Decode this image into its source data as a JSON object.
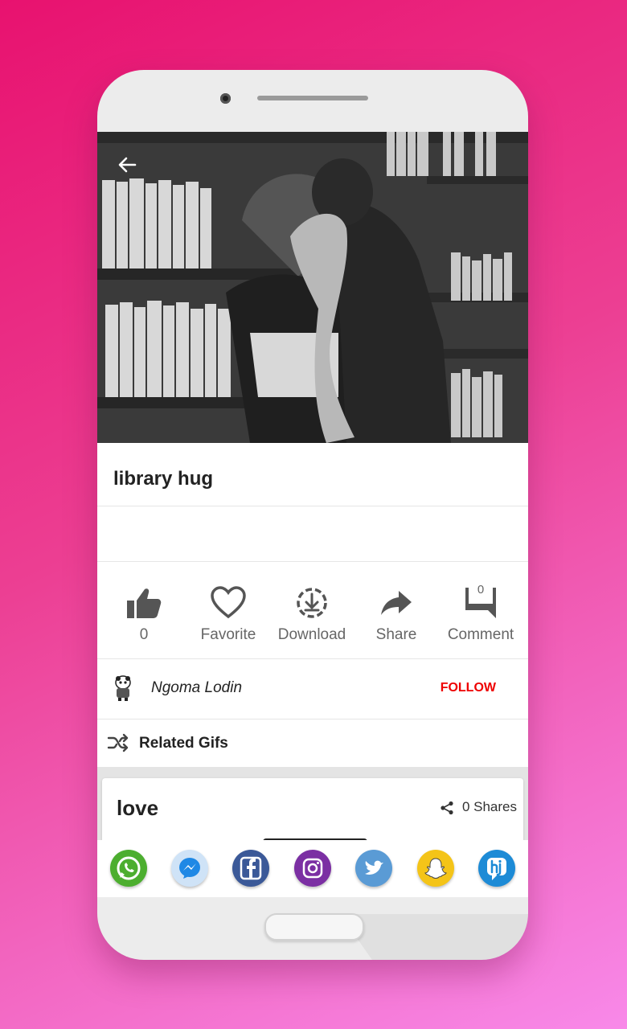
{
  "post": {
    "title": "library hug"
  },
  "actions": {
    "like": {
      "label": "0"
    },
    "favorite": {
      "label": "Favorite"
    },
    "download": {
      "label": "Download"
    },
    "share": {
      "label": "Share"
    },
    "comment": {
      "label": "Comment",
      "count": "0"
    }
  },
  "author": {
    "name": "Ngoma Lodin",
    "follow_label": "FOLLOW"
  },
  "related": {
    "label": "Related Gifs"
  },
  "related_card": {
    "title": "love",
    "shares": "0 Shares"
  },
  "share_apps": [
    "whatsapp-icon",
    "messenger-icon",
    "facebook-icon",
    "instagram-icon",
    "twitter-icon",
    "snapchat-icon",
    "hike-icon"
  ],
  "colors": {
    "follow": "#ee0000",
    "background_top": "#e8126f",
    "background_bottom": "#f889e9"
  }
}
